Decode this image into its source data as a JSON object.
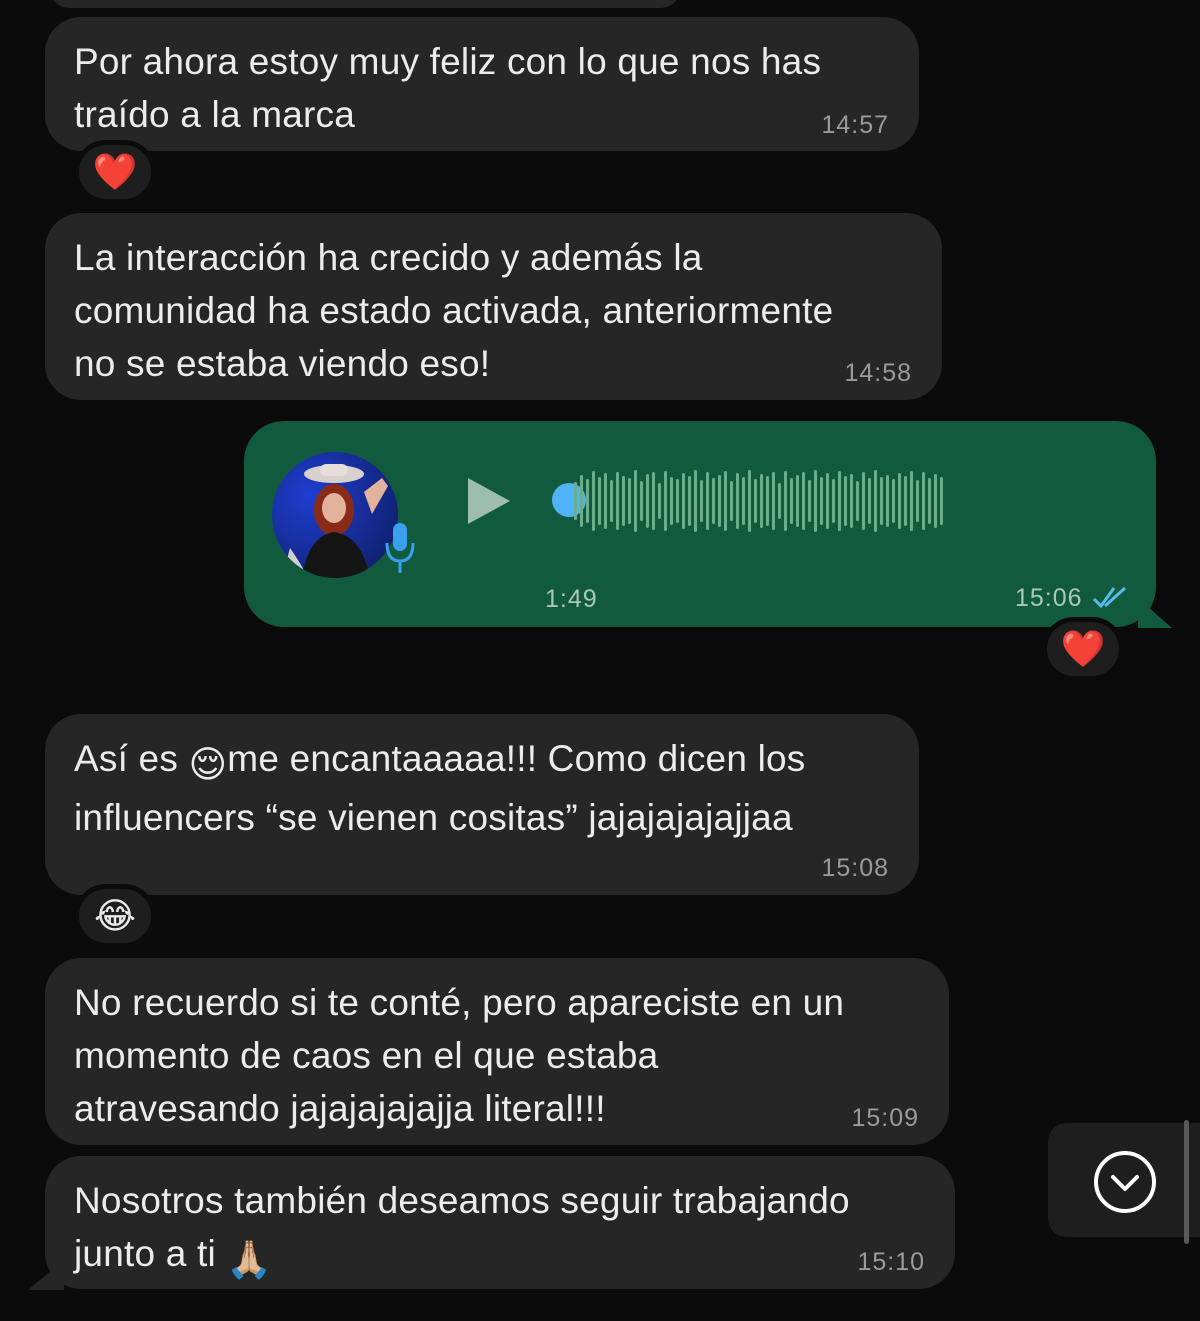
{
  "messages": [
    {
      "text_lines": [
        "Por ahora estoy muy feliz con lo que nos has",
        "traído a la marca"
      ],
      "time": "14:57",
      "reaction": "❤️"
    },
    {
      "text_lines": [
        "La interacción ha crecido y además la",
        "comunidad ha estado activada, anteriormente",
        "no se estaba viendo eso!"
      ],
      "time": "14:58"
    },
    {
      "voice": {
        "duration": "1:49",
        "time": "15:06",
        "status_icon": "double-check-icon",
        "progress": 0
      },
      "reaction": "❤️"
    },
    {
      "text_lines": [
        "Así es",
        "me encantaaaaa!!!  Como dicen los",
        "influencers “se vienen cositas” jajajajajajjaa"
      ],
      "emoji": "😌",
      "time": "15:08",
      "reaction": "😂"
    },
    {
      "text_lines": [
        "No recuerdo si te conté, pero apareciste en un",
        "momento de caos en el que estaba",
        "atravesando jajajajajajja literal!!!"
      ],
      "time": "15:09"
    },
    {
      "text_lines": [
        "Nosotros también deseamos seguir trabajando",
        "junto a ti"
      ],
      "emoji": "🙏🏼",
      "time": "15:10"
    }
  ],
  "colors": {
    "background": "#0b0b0b",
    "incoming_bubble": "#262626",
    "outgoing_bubble": "#125a3d",
    "read_check": "#53bdeb",
    "waveform": "#6cae8c",
    "progress_dot": "#4fb3f6"
  },
  "scroll_button_icon": "chevron-down-circle-icon"
}
